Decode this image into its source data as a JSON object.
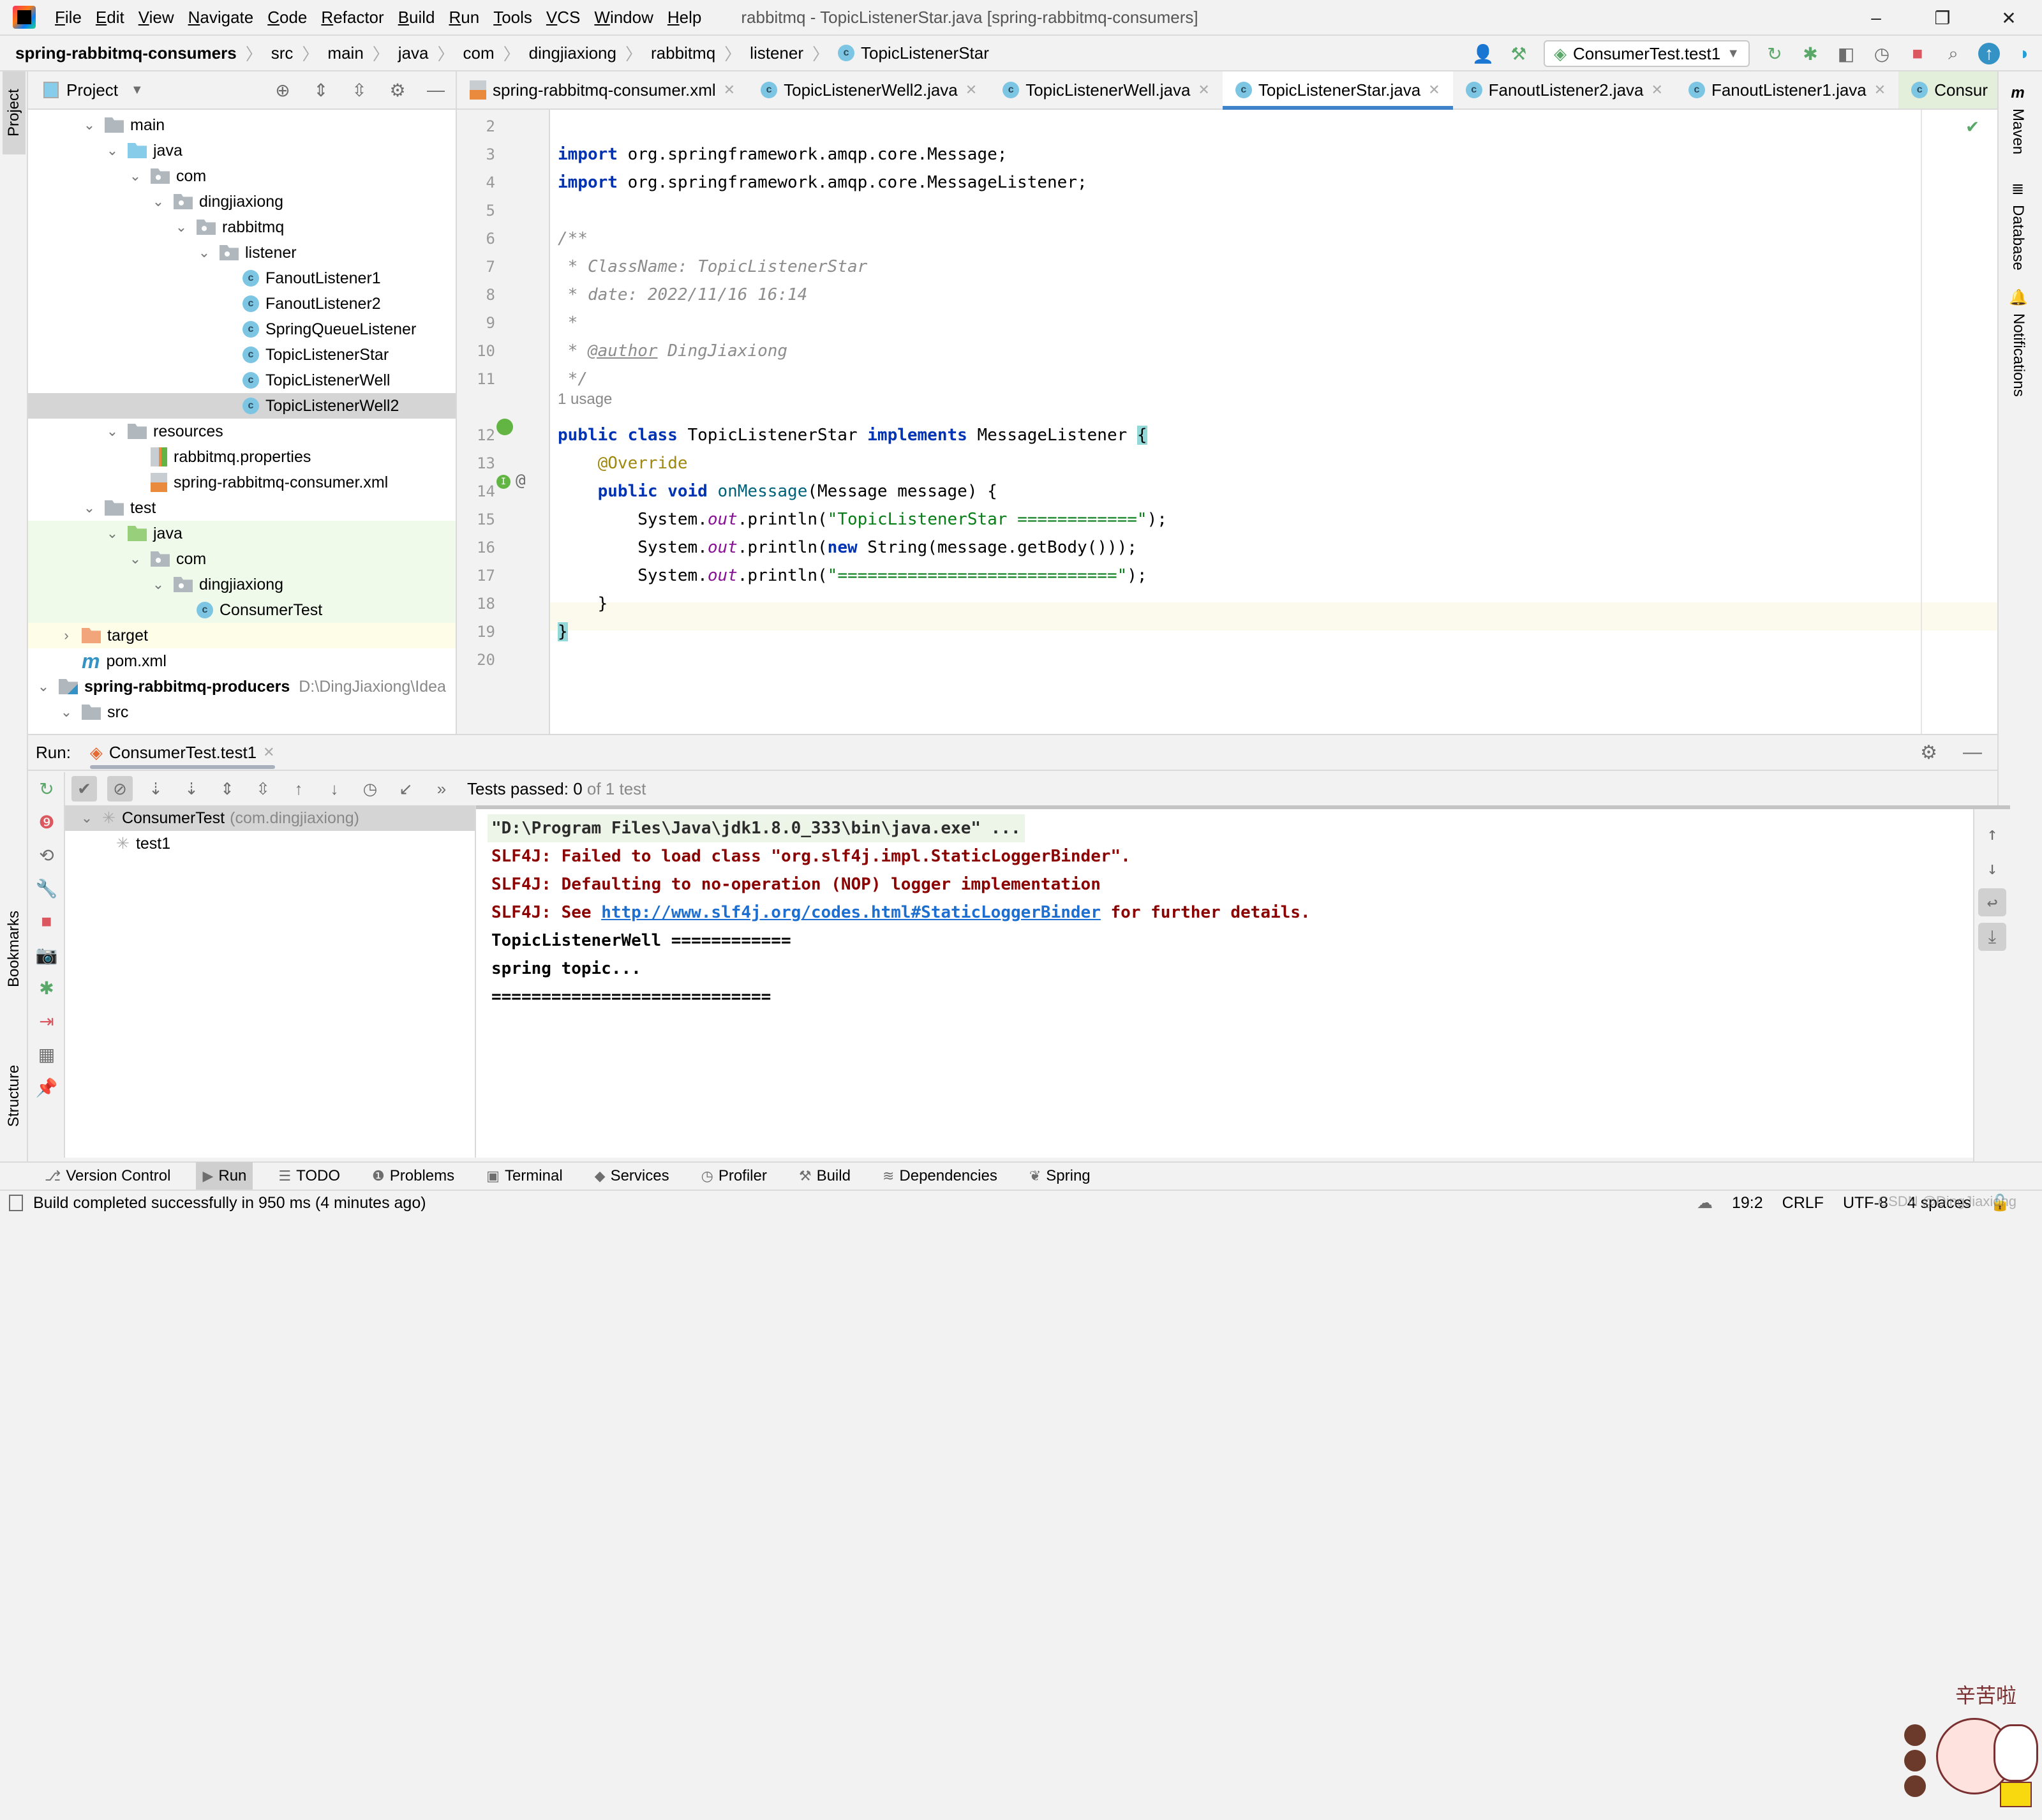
{
  "window": {
    "title": "rabbitmq - TopicListenerStar.java [spring-rabbitmq-consumers]",
    "menu": [
      "File",
      "Edit",
      "View",
      "Navigate",
      "Code",
      "Refactor",
      "Build",
      "Run",
      "Tools",
      "VCS",
      "Window",
      "Help"
    ],
    "controls": {
      "minimize": "–",
      "restore": "❐",
      "close": "✕"
    }
  },
  "breadcrumb": [
    "spring-rabbitmq-consumers",
    "src",
    "main",
    "java",
    "com",
    "dingjiaxiong",
    "rabbitmq",
    "listener",
    "TopicListenerStar"
  ],
  "toolbar": {
    "run_config": "ConsumerTest.test1",
    "icons": [
      "user-icon",
      "build-hammer-icon",
      "rerun-icon",
      "debug-icon",
      "coverage-icon",
      "profile-icon",
      "stop-icon",
      "search-icon",
      "update-icon",
      "toolbox-icon"
    ]
  },
  "left_stripe": {
    "project": "Project",
    "bookmarks": "Bookmarks",
    "structure": "Structure"
  },
  "right_stripe": {
    "maven": "Maven",
    "database": "Database",
    "notifications": "Notifications"
  },
  "project_panel": {
    "title": "Project",
    "tree": [
      {
        "label": "main",
        "indent": 2,
        "kind": "folder",
        "expanded": true
      },
      {
        "label": "java",
        "indent": 3,
        "kind": "src",
        "expanded": true
      },
      {
        "label": "com",
        "indent": 4,
        "kind": "pkg",
        "expanded": true
      },
      {
        "label": "dingjiaxiong",
        "indent": 5,
        "kind": "pkg",
        "expanded": true
      },
      {
        "label": "rabbitmq",
        "indent": 6,
        "kind": "pkg",
        "expanded": true
      },
      {
        "label": "listener",
        "indent": 7,
        "kind": "pkg",
        "expanded": true
      },
      {
        "label": "FanoutListener1",
        "indent": 8,
        "kind": "class"
      },
      {
        "label": "FanoutListener2",
        "indent": 8,
        "kind": "class"
      },
      {
        "label": "SpringQueueListener",
        "indent": 8,
        "kind": "class"
      },
      {
        "label": "TopicListenerStar",
        "indent": 8,
        "kind": "class"
      },
      {
        "label": "TopicListenerWell",
        "indent": 8,
        "kind": "class"
      },
      {
        "label": "TopicListenerWell2",
        "indent": 8,
        "kind": "class",
        "selected": true
      },
      {
        "label": "resources",
        "indent": 3,
        "kind": "res",
        "expanded": true
      },
      {
        "label": "rabbitmq.properties",
        "indent": 4,
        "kind": "props"
      },
      {
        "label": "spring-rabbitmq-consumer.xml",
        "indent": 4,
        "kind": "xml"
      },
      {
        "label": "test",
        "indent": 2,
        "kind": "folder",
        "expanded": true
      },
      {
        "label": "java",
        "indent": 3,
        "kind": "test",
        "expanded": true,
        "bg": "test"
      },
      {
        "label": "com",
        "indent": 4,
        "kind": "pkg",
        "expanded": true,
        "bg": "test"
      },
      {
        "label": "dingjiaxiong",
        "indent": 5,
        "kind": "pkg",
        "expanded": true,
        "bg": "test"
      },
      {
        "label": "ConsumerTest",
        "indent": 6,
        "kind": "testclass",
        "bg": "test"
      },
      {
        "label": "target",
        "indent": 1,
        "kind": "target",
        "expanded": false,
        "bg": "excluded"
      },
      {
        "label": "pom.xml",
        "indent": 1,
        "kind": "maven"
      },
      {
        "label": "spring-rabbitmq-producers",
        "indent": 0,
        "kind": "module",
        "expanded": true,
        "bold": true,
        "hint": "D:\\DingJiaxiong\\Idea"
      },
      {
        "label": "src",
        "indent": 1,
        "kind": "folder",
        "expanded": true
      }
    ]
  },
  "editor": {
    "tabs": [
      {
        "label": "spring-rabbitmq-consumer.xml",
        "icon": "xml"
      },
      {
        "label": "TopicListenerWell2.java",
        "icon": "class"
      },
      {
        "label": "TopicListenerWell.java",
        "icon": "class"
      },
      {
        "label": "TopicListenerStar.java",
        "icon": "class",
        "active": true
      },
      {
        "label": "FanoutListener2.java",
        "icon": "class"
      },
      {
        "label": "FanoutListener1.java",
        "icon": "class"
      },
      {
        "label": "Consur",
        "icon": "testclass",
        "partial": true
      }
    ],
    "usage_hint": "1 usage",
    "lines": [
      {
        "n": 2,
        "html": ""
      },
      {
        "n": 3,
        "html": "<span class='kw'>import</span> org.springframework.amqp.core.Message;"
      },
      {
        "n": 4,
        "html": "<span class='kw'>import</span> org.springframework.amqp.core.MessageListener;"
      },
      {
        "n": 5,
        "html": ""
      },
      {
        "n": 6,
        "html": "<span class='cm'>/**</span>"
      },
      {
        "n": 7,
        "html": "<span class='cm'> * ClassName: TopicListenerStar</span>"
      },
      {
        "n": 8,
        "html": "<span class='cm'> * date: 2022/11/16 16:14</span>"
      },
      {
        "n": 9,
        "html": "<span class='cm'> *</span>"
      },
      {
        "n": 10,
        "html": "<span class='cm'> * </span><span class='cmtag'>@author</span><span class='cm'> DingJiaxiong</span>"
      },
      {
        "n": 11,
        "html": "<span class='cm'> */</span>"
      },
      {
        "n": 12,
        "html": "<span class='kw'>public class</span> TopicListenerStar <span class='kw'>implements</span> MessageListener <span class='brace-hl'>{</span>"
      },
      {
        "n": 13,
        "html": "    <span class='ann'>@Override</span>"
      },
      {
        "n": 14,
        "html": "    <span class='kw'>public void</span> <span class='fn'>onMessage</span>(Message message) {"
      },
      {
        "n": 15,
        "html": "        System.<span class='sf'>out</span>.println(<span class='st'>\"TopicListenerStar ============\"</span>);"
      },
      {
        "n": 16,
        "html": "        System.<span class='sf'>out</span>.println(<span class='kw'>new</span> String(message.getBody()));"
      },
      {
        "n": 17,
        "html": "        System.<span class='sf'>out</span>.println(<span class='st'>\"============================\"</span>);"
      },
      {
        "n": 18,
        "html": "    }"
      },
      {
        "n": 19,
        "html": "<span class='brace-hl'>}</span>"
      },
      {
        "n": 20,
        "html": ""
      }
    ]
  },
  "run_panel": {
    "label": "Run:",
    "tab": "ConsumerTest.test1",
    "tests_status_prefix": "Tests passed: ",
    "tests_passed": "0",
    "tests_total_text": " of 1 test",
    "test_tree": [
      {
        "label": "ConsumerTest",
        "hint": "(com.dingjiaxiong)",
        "selected": true
      },
      {
        "label": "test1"
      }
    ],
    "console": [
      {
        "type": "cmd",
        "text": "\"D:\\Program Files\\Java\\jdk1.8.0_333\\bin\\java.exe\" ..."
      },
      {
        "type": "err",
        "text": "SLF4J: Failed to load class \"org.slf4j.impl.StaticLoggerBinder\"."
      },
      {
        "type": "err",
        "text": "SLF4J: Defaulting to no-operation (NOP) logger implementation"
      },
      {
        "type": "err",
        "pre": "SLF4J: See ",
        "link": "http://www.slf4j.org/codes.html#StaticLoggerBinder",
        "post": " for further details."
      },
      {
        "type": "out",
        "text": "TopicListenerWell ============"
      },
      {
        "type": "out",
        "text": "spring topic..."
      },
      {
        "type": "out",
        "text": "============================"
      }
    ],
    "sticker_text": "辛苦啦"
  },
  "bottom_bar": [
    {
      "label": "Version Control",
      "icon": "⎇"
    },
    {
      "label": "Run",
      "icon": "▶",
      "active": true
    },
    {
      "label": "TODO",
      "icon": "☰"
    },
    {
      "label": "Problems",
      "icon": "❶"
    },
    {
      "label": "Terminal",
      "icon": "▣"
    },
    {
      "label": "Services",
      "icon": "◆"
    },
    {
      "label": "Profiler",
      "icon": "◷"
    },
    {
      "label": "Build",
      "icon": "⚒"
    },
    {
      "label": "Dependencies",
      "icon": "≋"
    },
    {
      "label": "Spring",
      "icon": "❦"
    }
  ],
  "status_bar": {
    "message": "Build completed successfully in 950 ms (4 minutes ago)",
    "position": "19:2",
    "line_sep": "CRLF",
    "encoding": "UTF-8",
    "indent": "4 spaces",
    "watermark": "CSDN @DingJiaxiong"
  },
  "colors": {
    "accent": "#4083c9",
    "keyword": "#0033b3",
    "string": "#067d17",
    "error": "#8b0000",
    "link": "#1d6ed1",
    "class_icon": "#7cc6e4"
  }
}
